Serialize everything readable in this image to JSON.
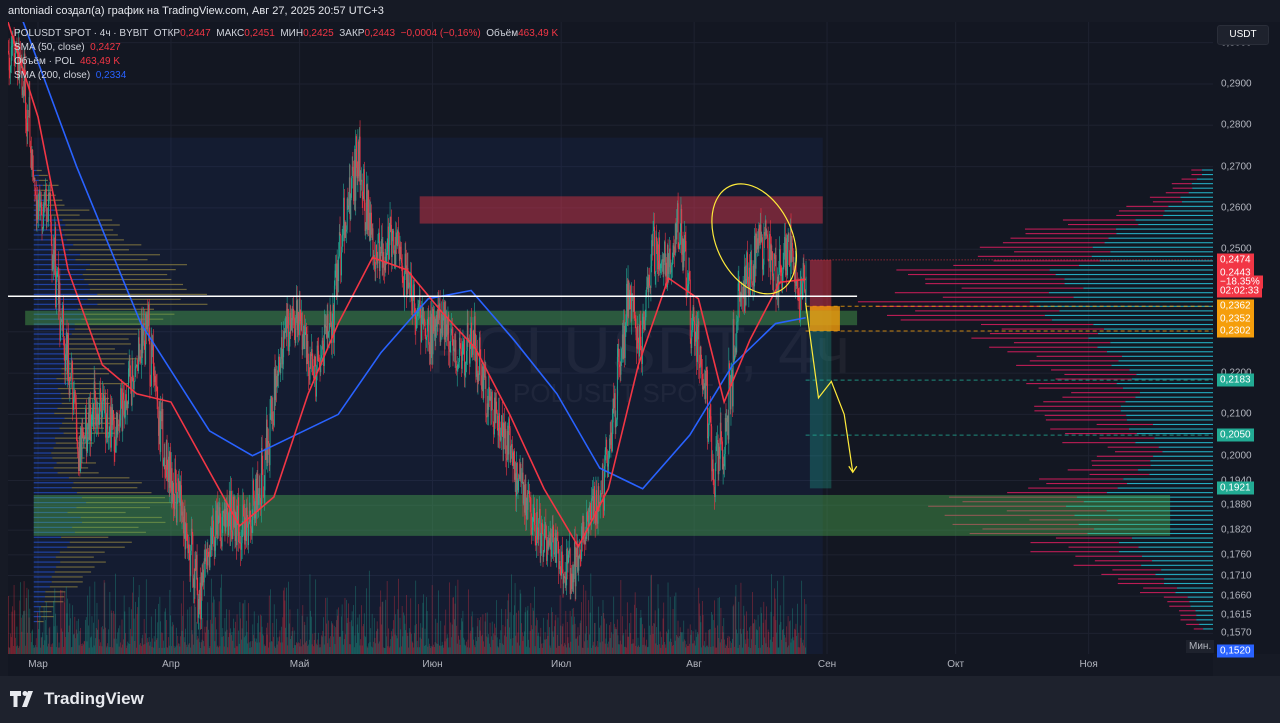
{
  "header": {
    "credit": "antoniadi создал(а) график на TradingView.com, Авг 27, 2025 20:57 UTC+3"
  },
  "legend": {
    "symbol": "POLUSDT SPOT · 4ч · BYBIT",
    "open_label": "ОТКР",
    "open": "0,2447",
    "high_label": "МАКС",
    "high": "0,2451",
    "low_label": "МИН",
    "low": "0,2425",
    "close_label": "ЗАКР",
    "close": "0,2443",
    "change": "−0,0004 (−0,16%)",
    "volume_label": "Объём",
    "volume": "463,49 K",
    "sma50_label": "SMA (50, close)",
    "sma50": "0,2427",
    "vol_pol_label": "Объём · POL",
    "vol_pol": "463,49 K",
    "sma200_label": "SMA (200, close)",
    "sma200": "0,2334"
  },
  "watermark": {
    "line1": "POLUSDT, 4ч",
    "line2": "POLUSDT SPOT"
  },
  "price_axis": {
    "currency": "USDT",
    "ticks": [
      "0,3000",
      "0,2900",
      "0,2800",
      "0,2700",
      "0,2600",
      "0,2500",
      "0,2300",
      "0,2200",
      "0,2100",
      "0,2000",
      "0,1940",
      "0,1880",
      "0,1820",
      "0,1760",
      "0,1710",
      "0,1660",
      "0,1615",
      "0,1570"
    ],
    "tags": [
      {
        "text": "0,2474",
        "color": "#f23645"
      },
      {
        "text": "0,2443",
        "color": "#f23645"
      },
      {
        "text": "−18,35%",
        "color": "#f23645"
      },
      {
        "text": "02:02:33",
        "color": "#f23645"
      },
      {
        "text": "0,2362",
        "color": "#f59e0b"
      },
      {
        "text": "0,2352",
        "color": "#f59e0b"
      },
      {
        "text": "0,2302",
        "color": "#f59e0b"
      },
      {
        "text": "0,2183",
        "color": "#22ab94"
      },
      {
        "text": "0,2050",
        "color": "#22ab94"
      },
      {
        "text": "0,1921",
        "color": "#22ab94"
      },
      {
        "text": "0,1520",
        "color": "#2962ff"
      }
    ],
    "min_label": "Мин."
  },
  "time_axis": {
    "labels": [
      "Мар",
      "Апр",
      "Май",
      "Июн",
      "Июл",
      "Авг",
      "Сен",
      "Окт",
      "Ноя"
    ]
  },
  "colors": {
    "up": "#22ab94",
    "down": "#f23645",
    "sma50": "#f23645",
    "sma200": "#2962ff",
    "profile_blue": "#26c6da",
    "profile_pink": "#e91e63",
    "accent_orange": "#f59e0b",
    "drawing_yellow": "#ffeb3b"
  },
  "chart_data": {
    "type": "candlestick",
    "symbol": "POLUSDT SPOT",
    "timeframe": "4ч",
    "exchange": "BYBIT",
    "ylim": [
      0.152,
      0.305
    ],
    "xlim": [
      "2025-02-22",
      "2025-11-30"
    ],
    "close_path": [
      {
        "x": "2025-02-22",
        "y": 0.298
      },
      {
        "x": "2025-02-25",
        "y": 0.292
      },
      {
        "x": "2025-02-28",
        "y": 0.262
      },
      {
        "x": "2025-03-03",
        "y": 0.258
      },
      {
        "x": "2025-03-06",
        "y": 0.232
      },
      {
        "x": "2025-03-10",
        "y": 0.202
      },
      {
        "x": "2025-03-14",
        "y": 0.212
      },
      {
        "x": "2025-03-18",
        "y": 0.206
      },
      {
        "x": "2025-03-22",
        "y": 0.218
      },
      {
        "x": "2025-03-26",
        "y": 0.231
      },
      {
        "x": "2025-03-30",
        "y": 0.198
      },
      {
        "x": "2025-04-03",
        "y": 0.187
      },
      {
        "x": "2025-04-07",
        "y": 0.166
      },
      {
        "x": "2025-04-10",
        "y": 0.181
      },
      {
        "x": "2025-04-14",
        "y": 0.186
      },
      {
        "x": "2025-04-18",
        "y": 0.182
      },
      {
        "x": "2025-04-22",
        "y": 0.196
      },
      {
        "x": "2025-04-26",
        "y": 0.226
      },
      {
        "x": "2025-04-30",
        "y": 0.234
      },
      {
        "x": "2025-05-04",
        "y": 0.22
      },
      {
        "x": "2025-05-08",
        "y": 0.232
      },
      {
        "x": "2025-05-11",
        "y": 0.258
      },
      {
        "x": "2025-05-14",
        "y": 0.272
      },
      {
        "x": "2025-05-18",
        "y": 0.248
      },
      {
        "x": "2025-05-22",
        "y": 0.252
      },
      {
        "x": "2025-05-26",
        "y": 0.24
      },
      {
        "x": "2025-05-30",
        "y": 0.228
      },
      {
        "x": "2025-06-03",
        "y": 0.232
      },
      {
        "x": "2025-06-07",
        "y": 0.224
      },
      {
        "x": "2025-06-10",
        "y": 0.228
      },
      {
        "x": "2025-06-14",
        "y": 0.211
      },
      {
        "x": "2025-06-18",
        "y": 0.204
      },
      {
        "x": "2025-06-22",
        "y": 0.188
      },
      {
        "x": "2025-06-26",
        "y": 0.18
      },
      {
        "x": "2025-06-30",
        "y": 0.176
      },
      {
        "x": "2025-07-03",
        "y": 0.17
      },
      {
        "x": "2025-07-07",
        "y": 0.184
      },
      {
        "x": "2025-07-10",
        "y": 0.192
      },
      {
        "x": "2025-07-13",
        "y": 0.212
      },
      {
        "x": "2025-07-16",
        "y": 0.238
      },
      {
        "x": "2025-07-19",
        "y": 0.228
      },
      {
        "x": "2025-07-22",
        "y": 0.25
      },
      {
        "x": "2025-07-25",
        "y": 0.246
      },
      {
        "x": "2025-07-28",
        "y": 0.256
      },
      {
        "x": "2025-07-31",
        "y": 0.232
      },
      {
        "x": "2025-08-03",
        "y": 0.217
      },
      {
        "x": "2025-08-05",
        "y": 0.196
      },
      {
        "x": "2025-08-08",
        "y": 0.206
      },
      {
        "x": "2025-08-11",
        "y": 0.238
      },
      {
        "x": "2025-08-14",
        "y": 0.246
      },
      {
        "x": "2025-08-17",
        "y": 0.252
      },
      {
        "x": "2025-08-20",
        "y": 0.244
      },
      {
        "x": "2025-08-23",
        "y": 0.25
      },
      {
        "x": "2025-08-25",
        "y": 0.238
      },
      {
        "x": "2025-08-27",
        "y": 0.2443
      }
    ],
    "sma50_path": [
      {
        "x": "2025-02-22",
        "y": 0.305
      },
      {
        "x": "2025-03-01",
        "y": 0.282
      },
      {
        "x": "2025-03-08",
        "y": 0.245
      },
      {
        "x": "2025-03-16",
        "y": 0.222
      },
      {
        "x": "2025-03-24",
        "y": 0.215
      },
      {
        "x": "2025-04-01",
        "y": 0.213
      },
      {
        "x": "2025-04-09",
        "y": 0.198
      },
      {
        "x": "2025-04-17",
        "y": 0.183
      },
      {
        "x": "2025-04-25",
        "y": 0.19
      },
      {
        "x": "2025-05-03",
        "y": 0.215
      },
      {
        "x": "2025-05-10",
        "y": 0.232
      },
      {
        "x": "2025-05-18",
        "y": 0.248
      },
      {
        "x": "2025-05-26",
        "y": 0.245
      },
      {
        "x": "2025-06-03",
        "y": 0.235
      },
      {
        "x": "2025-06-11",
        "y": 0.226
      },
      {
        "x": "2025-06-19",
        "y": 0.21
      },
      {
        "x": "2025-06-27",
        "y": 0.192
      },
      {
        "x": "2025-07-05",
        "y": 0.178
      },
      {
        "x": "2025-07-12",
        "y": 0.192
      },
      {
        "x": "2025-07-19",
        "y": 0.222
      },
      {
        "x": "2025-07-26",
        "y": 0.243
      },
      {
        "x": "2025-08-02",
        "y": 0.238
      },
      {
        "x": "2025-08-08",
        "y": 0.213
      },
      {
        "x": "2025-08-14",
        "y": 0.228
      },
      {
        "x": "2025-08-21",
        "y": 0.242
      },
      {
        "x": "2025-08-27",
        "y": 0.2427
      }
    ],
    "sma200_path": [
      {
        "x": "2025-02-22",
        "y": 0.315
      },
      {
        "x": "2025-03-10",
        "y": 0.27
      },
      {
        "x": "2025-03-25",
        "y": 0.232
      },
      {
        "x": "2025-04-10",
        "y": 0.206
      },
      {
        "x": "2025-04-20",
        "y": 0.2
      },
      {
        "x": "2025-04-30",
        "y": 0.205
      },
      {
        "x": "2025-05-10",
        "y": 0.21
      },
      {
        "x": "2025-05-20",
        "y": 0.225
      },
      {
        "x": "2025-05-31",
        "y": 0.238
      },
      {
        "x": "2025-06-10",
        "y": 0.24
      },
      {
        "x": "2025-06-20",
        "y": 0.228
      },
      {
        "x": "2025-06-30",
        "y": 0.215
      },
      {
        "x": "2025-07-10",
        "y": 0.197
      },
      {
        "x": "2025-07-20",
        "y": 0.192
      },
      {
        "x": "2025-07-31",
        "y": 0.205
      },
      {
        "x": "2025-08-10",
        "y": 0.222
      },
      {
        "x": "2025-08-20",
        "y": 0.232
      },
      {
        "x": "2025-08-27",
        "y": 0.2334
      }
    ],
    "zones": [
      {
        "kind": "resistance",
        "color": "#f23645",
        "y1": 0.2562,
        "y2": 0.2628,
        "x1": "2025-05-29",
        "x2": "2025-08-31"
      },
      {
        "kind": "support",
        "color": "#22ab94",
        "y1": 0.2316,
        "y2": 0.2351,
        "x1": "2025-02-26",
        "x2": "2025-09-08"
      },
      {
        "kind": "support",
        "color": "#22ab94",
        "y1": 0.1806,
        "y2": 0.1905,
        "x1": "2025-02-28",
        "x2": "2025-11-20"
      }
    ],
    "levels": [
      {
        "y": 0.2474,
        "style": "dotted",
        "color": "#f23645"
      },
      {
        "y": 0.2362,
        "style": "dashed",
        "color": "#f59e0b"
      },
      {
        "y": 0.2302,
        "style": "dashed",
        "color": "#f59e0b"
      },
      {
        "y": 0.2183,
        "style": "dashed",
        "color": "#22ab94"
      },
      {
        "y": 0.205,
        "style": "dashed",
        "color": "#22ab94"
      }
    ],
    "horizontal_line": {
      "y": 0.2386,
      "color": "#ffffff"
    },
    "projection_arrow": [
      {
        "x": "2025-08-27",
        "y": 0.237
      },
      {
        "x": "2025-08-30",
        "y": 0.214
      },
      {
        "x": "2025-09-02",
        "y": 0.218
      },
      {
        "x": "2025-09-05",
        "y": 0.21
      },
      {
        "x": "2025-09-07",
        "y": 0.196
      }
    ],
    "volume_profile_levels": [
      {
        "price": 0.27,
        "left": 0.05,
        "right": 0.03
      },
      {
        "price": 0.262,
        "left": 0.2,
        "right": 0.1
      },
      {
        "price": 0.254,
        "left": 0.6,
        "right": 0.3
      },
      {
        "price": 0.246,
        "left": 0.85,
        "right": 0.45
      },
      {
        "price": 0.238,
        "left": 1.0,
        "right": 0.55
      },
      {
        "price": 0.23,
        "left": 0.75,
        "right": 0.45
      },
      {
        "price": 0.222,
        "left": 0.55,
        "right": 0.4
      },
      {
        "price": 0.214,
        "left": 0.5,
        "right": 0.38
      },
      {
        "price": 0.206,
        "left": 0.45,
        "right": 0.3
      },
      {
        "price": 0.198,
        "left": 0.35,
        "right": 0.22
      },
      {
        "price": 0.19,
        "left": 0.8,
        "right": 0.55
      },
      {
        "price": 0.182,
        "left": 0.7,
        "right": 0.5
      },
      {
        "price": 0.174,
        "left": 0.4,
        "right": 0.3
      },
      {
        "price": 0.166,
        "left": 0.2,
        "right": 0.15
      },
      {
        "price": 0.158,
        "left": 0.05,
        "right": 0.04
      }
    ]
  }
}
